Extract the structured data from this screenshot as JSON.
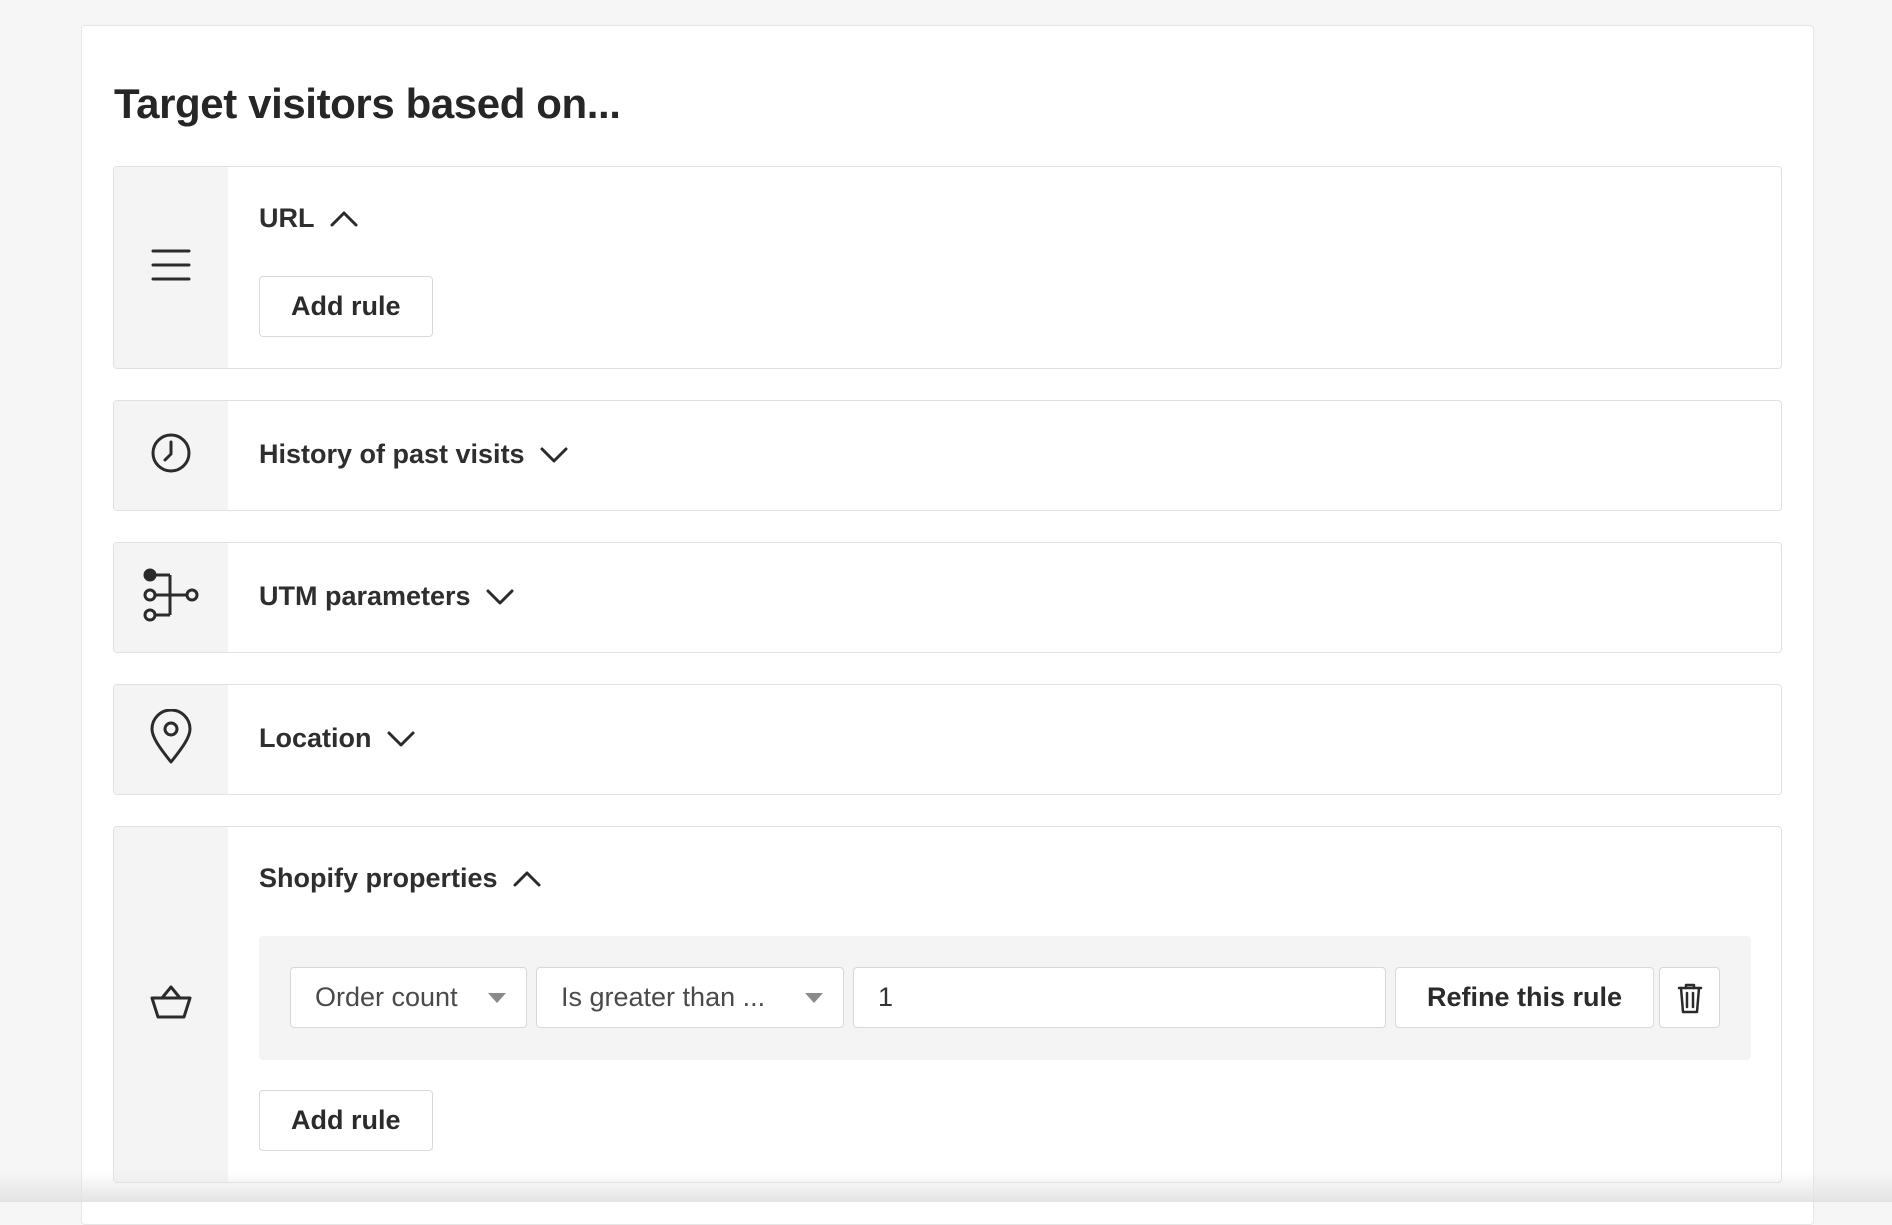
{
  "heading": "Target visitors based on...",
  "sections": {
    "url": {
      "title": "URL",
      "expanded": true,
      "add_rule_label": "Add rule",
      "icon": "list-icon"
    },
    "history": {
      "title": "History of past visits",
      "expanded": false,
      "icon": "clock-icon"
    },
    "utm": {
      "title": "UTM parameters",
      "expanded": false,
      "icon": "utm-branch-icon"
    },
    "location": {
      "title": "Location",
      "expanded": false,
      "icon": "map-pin-icon"
    },
    "shopify": {
      "title": "Shopify properties",
      "expanded": true,
      "icon": "basket-icon",
      "rule": {
        "property": "Order count",
        "operator": "Is greater than ...",
        "value": "1",
        "refine_label": "Refine this rule"
      },
      "add_rule_label": "Add rule"
    }
  }
}
